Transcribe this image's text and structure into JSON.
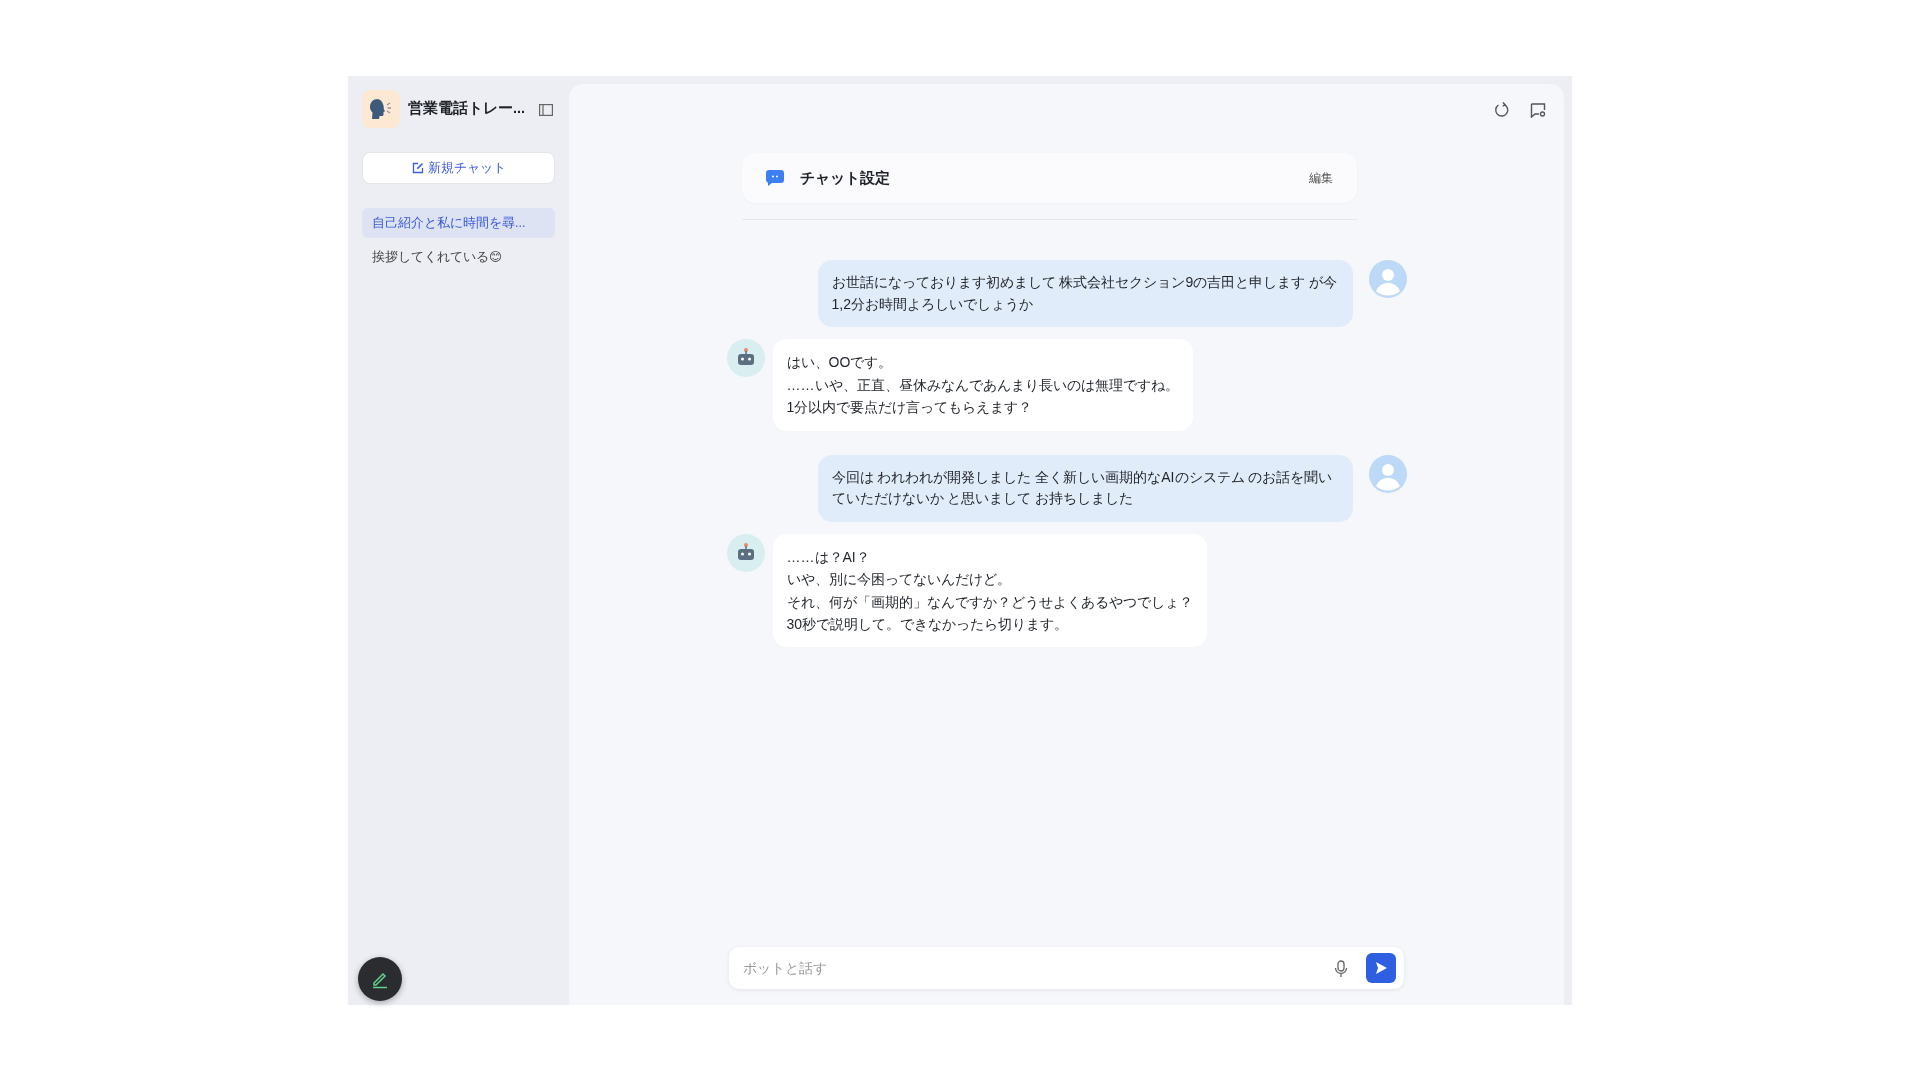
{
  "sidebar": {
    "app_title": "営業電話トレー...",
    "new_chat_button": "新規チャット",
    "conversations": [
      {
        "title": "自己紹介と私に時間を尋...",
        "selected": true
      },
      {
        "title": "挨拶してくれている😊",
        "selected": false
      }
    ]
  },
  "chat_settings": {
    "title": "チャット設定",
    "edit_link": "編集"
  },
  "messages": [
    {
      "kind": "user",
      "lines": [
        "お世話になっております初めまして 株式会社セクション9の吉田と申します が今1,2分お時間よろしいでしょうか"
      ]
    },
    {
      "kind": "bot",
      "lines": [
        "はい、OOです。",
        "……いや、正直、昼休みなんであんまり長いのは無理ですね。",
        "1分以内で要点だけ言ってもらえます？"
      ]
    },
    {
      "kind": "user",
      "lines": [
        "今回は われわれが開発しました 全く新しい画期的なAIのシステム のお話を聞いていただけないか と思いまして お持ちしました"
      ]
    },
    {
      "kind": "bot",
      "lines": [
        "……は？AI？",
        "いや、別に今困ってないんだけど。",
        "それ、何が「画期的」なんですか？どうせよくあるやつでしょ？",
        "30秒で説明して。できなかったら切ります。"
      ]
    }
  ],
  "input": {
    "placeholder": "ボットと話す"
  }
}
